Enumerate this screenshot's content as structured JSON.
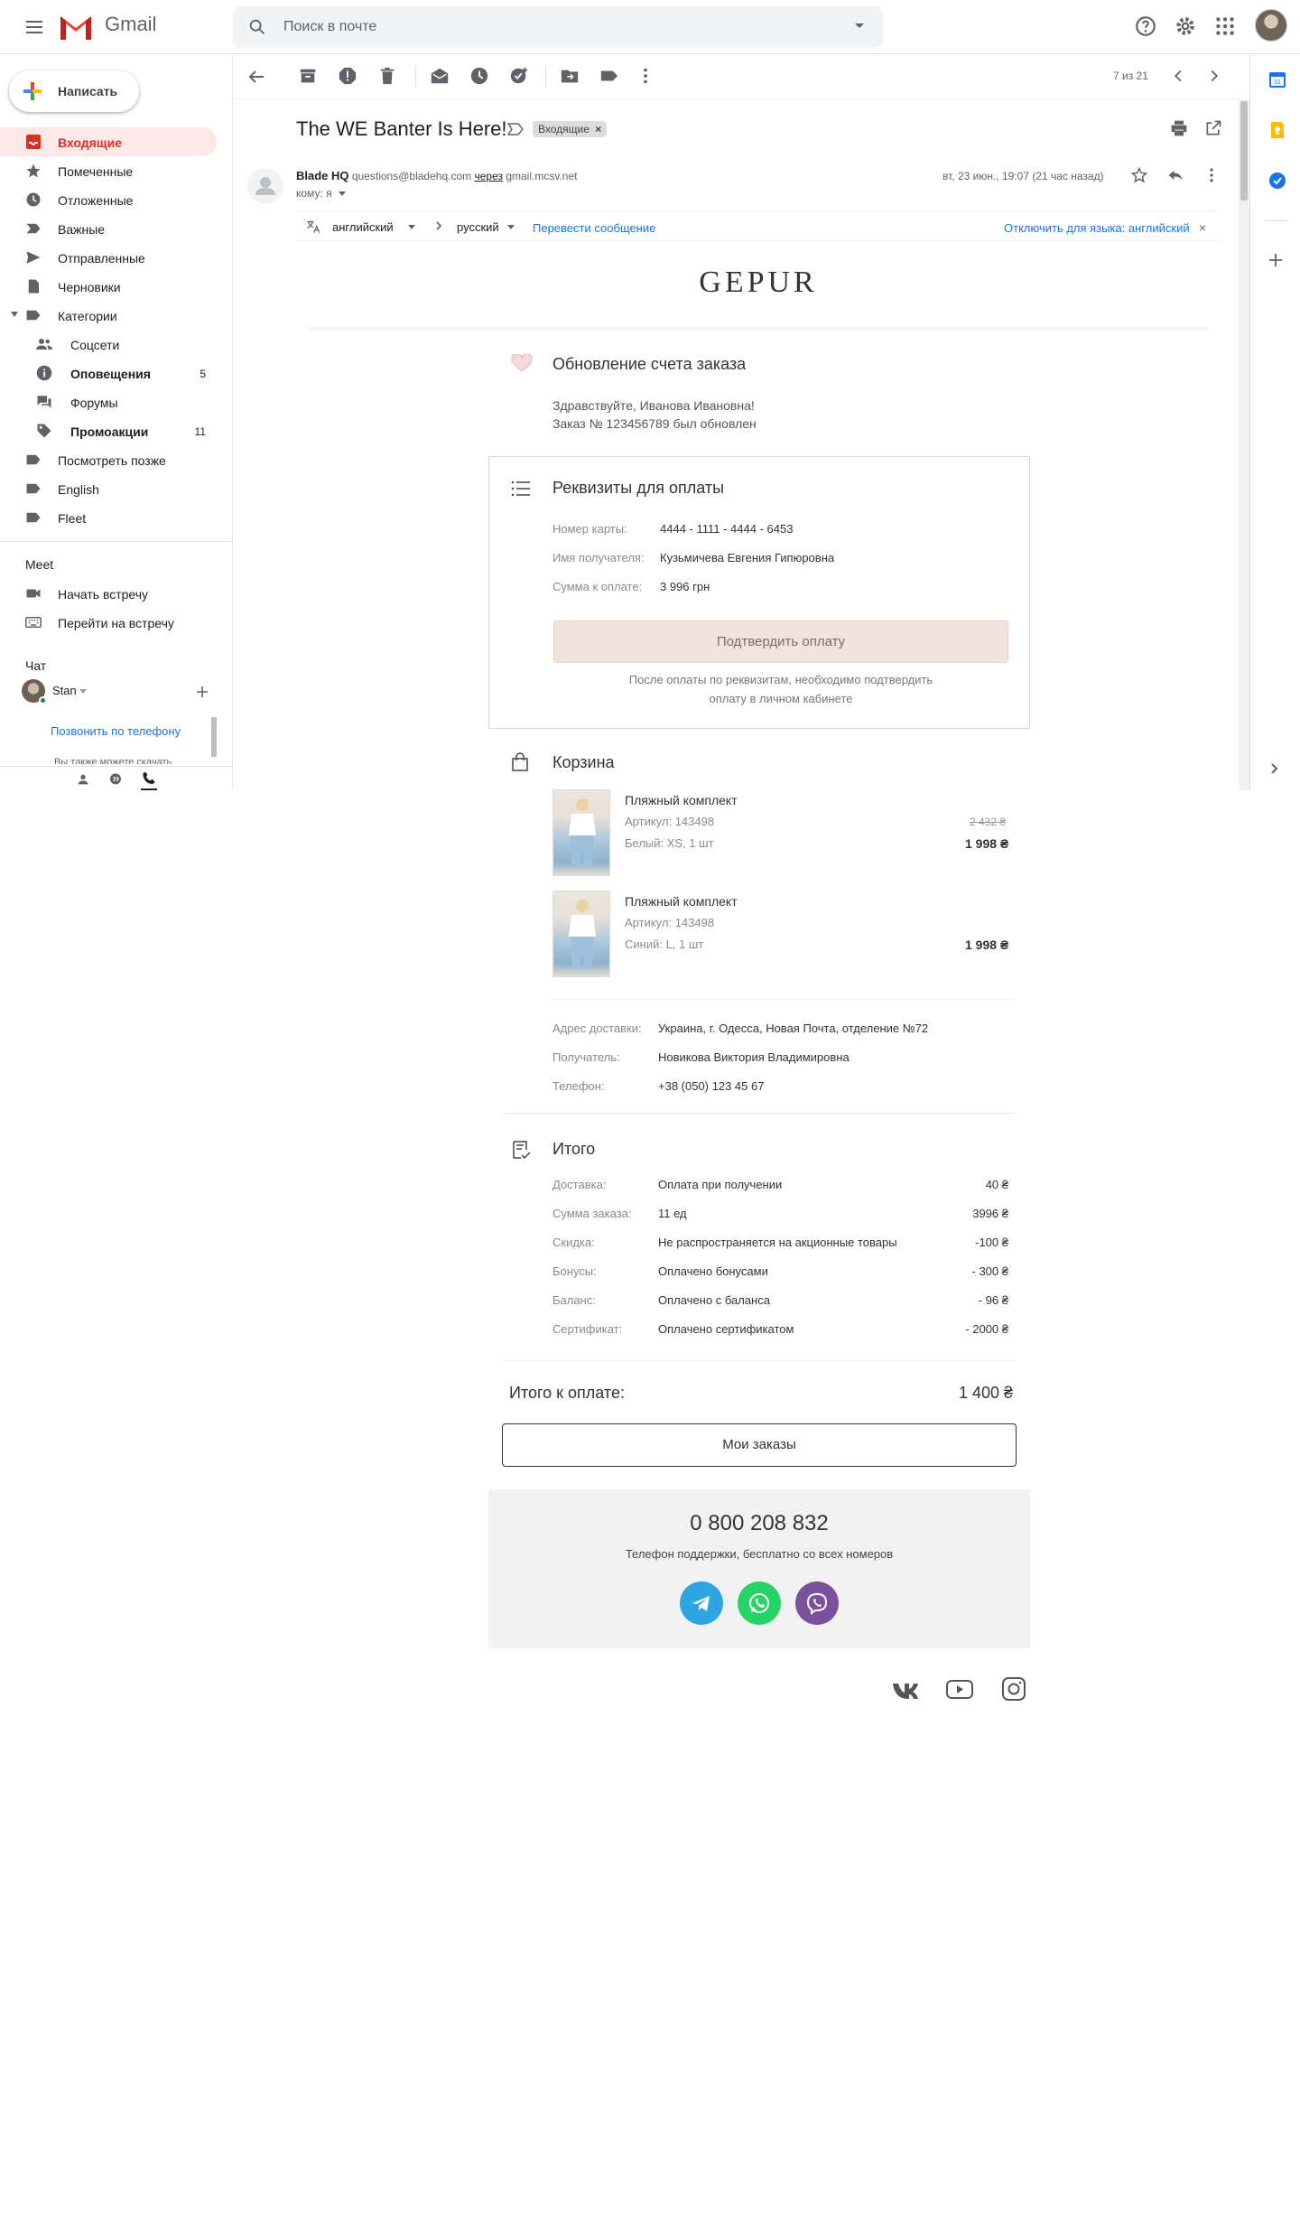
{
  "app": {
    "logo_text": "Gmail",
    "search_placeholder": "Поиск в почте"
  },
  "sidebar": {
    "compose_label": "Написать",
    "items": [
      {
        "label": "Входящие",
        "icon": "inbox-icon"
      },
      {
        "label": "Помеченные",
        "icon": "star-icon"
      },
      {
        "label": "Отложенные",
        "icon": "clock-icon"
      },
      {
        "label": "Важные",
        "icon": "important-icon"
      },
      {
        "label": "Отправленные",
        "icon": "send-icon"
      },
      {
        "label": "Черновики",
        "icon": "draft-icon"
      },
      {
        "label": "Категории",
        "icon": "label-icon"
      },
      {
        "label": "Соцсети",
        "icon": "people-icon"
      },
      {
        "label": "Оповещения",
        "icon": "info-icon",
        "count": "5"
      },
      {
        "label": "Форумы",
        "icon": "forum-icon"
      },
      {
        "label": "Промоакции",
        "icon": "tag-icon",
        "count": "11"
      },
      {
        "label": "Посмотреть позже",
        "icon": "label-icon"
      },
      {
        "label": "English",
        "icon": "label-icon"
      },
      {
        "label": "Fleet",
        "icon": "label-icon"
      }
    ],
    "meet_title": "Meet",
    "meet_items": [
      "Начать встречу",
      "Перейти на встречу"
    ],
    "chat_title": "Чат",
    "chat_user": "Stan",
    "call_link": "Позвонить по телефону",
    "faded_text": "Вы также можете скачать"
  },
  "toolbar": {
    "pager": "7 из 21"
  },
  "message": {
    "subject": "The WE Banter Is Here!",
    "label_chip": "Входящие",
    "sender_name": "Blade HQ",
    "sender_email": "questions@bladehq.com",
    "via_word": "через",
    "via_domain": "gmail.mcsv.net",
    "to_line": "кому: я",
    "date": "вт, 23 июн., 19:07 (21 час назад)",
    "translate": {
      "from": "английский",
      "to": "русский",
      "action": "Перевести сообщение",
      "disable": "Отключить для языка: английский"
    }
  },
  "email": {
    "brand": "GEPUR",
    "update_title": "Обновление счета заказа",
    "greeting": "Здравствуйте, Иванова Ивановна!",
    "order_updated": "Заказ № 123456789 был обновлен",
    "payment": {
      "title": "Реквизиты для оплаты",
      "card_label": "Номер карты:",
      "card_value": "4444 - 1111 - 4444 - 6453",
      "recipient_label": "Имя получателя:",
      "recipient_value": "Кузьмичева Евгения Гипюровна",
      "sum_label": "Сумма к оплате:",
      "sum_value": "3 996 грн",
      "confirm_button": "Подтвердить оплату",
      "note_line1": "После оплаты по реквизитам, необходимо подтвердить",
      "note_line2": "оплату в личном кабинете"
    },
    "cart": {
      "title": "Корзина",
      "items": [
        {
          "name": "Пляжный комплект",
          "sku": "Артикул: 143498",
          "variant": "Белый: XS, 1 шт",
          "old_price": "2 432 ₴",
          "price": "1 998 ₴"
        },
        {
          "name": "Пляжный комплект",
          "sku": "Артикул: 143498",
          "variant": "Синий: L, 1 шт",
          "old_price": "",
          "price": "1 998 ₴"
        }
      ],
      "delivery_label": "Адрес доставки:",
      "delivery_value": "Украина, г. Одесса, Новая Почта, отделение №72",
      "receiver_label": "Получатель:",
      "receiver_value": "Новикова Виктория Владимировна",
      "phone_label": "Телефон:",
      "phone_value": "+38 (050) 123 45 67"
    },
    "summary": {
      "title": "Итого",
      "rows": [
        {
          "label": "Доставка:",
          "desc": "Оплата при получении",
          "amount": "40 ₴"
        },
        {
          "label": "Сумма заказа:",
          "desc": "11 ед",
          "amount": "3996 ₴"
        },
        {
          "label": "Скидка:",
          "desc": "Не распространяется на акционные товары",
          "amount": "-100 ₴"
        },
        {
          "label": "Бонусы:",
          "desc": "Оплачено бонусами",
          "amount": "- 300 ₴"
        },
        {
          "label": "Баланс:",
          "desc": "Оплачено с баланса",
          "amount": "- 96 ₴"
        },
        {
          "label": "Сертификат:",
          "desc": "Оплачено сертификатом",
          "amount": "- 2000 ₴"
        }
      ],
      "total_label": "Итого к оплате:",
      "total_value": "1 400 ₴"
    },
    "orders_button": "Мои заказы",
    "support": {
      "phone": "0 800 208 832",
      "note": "Телефон поддержки, бесплатно со всех номеров"
    }
  },
  "colors": {
    "accent_red": "#d93025",
    "link_blue": "#1a73e8",
    "telegram": "#2ca5e0",
    "whatsapp": "#25d366",
    "viber": "#7b519d"
  }
}
